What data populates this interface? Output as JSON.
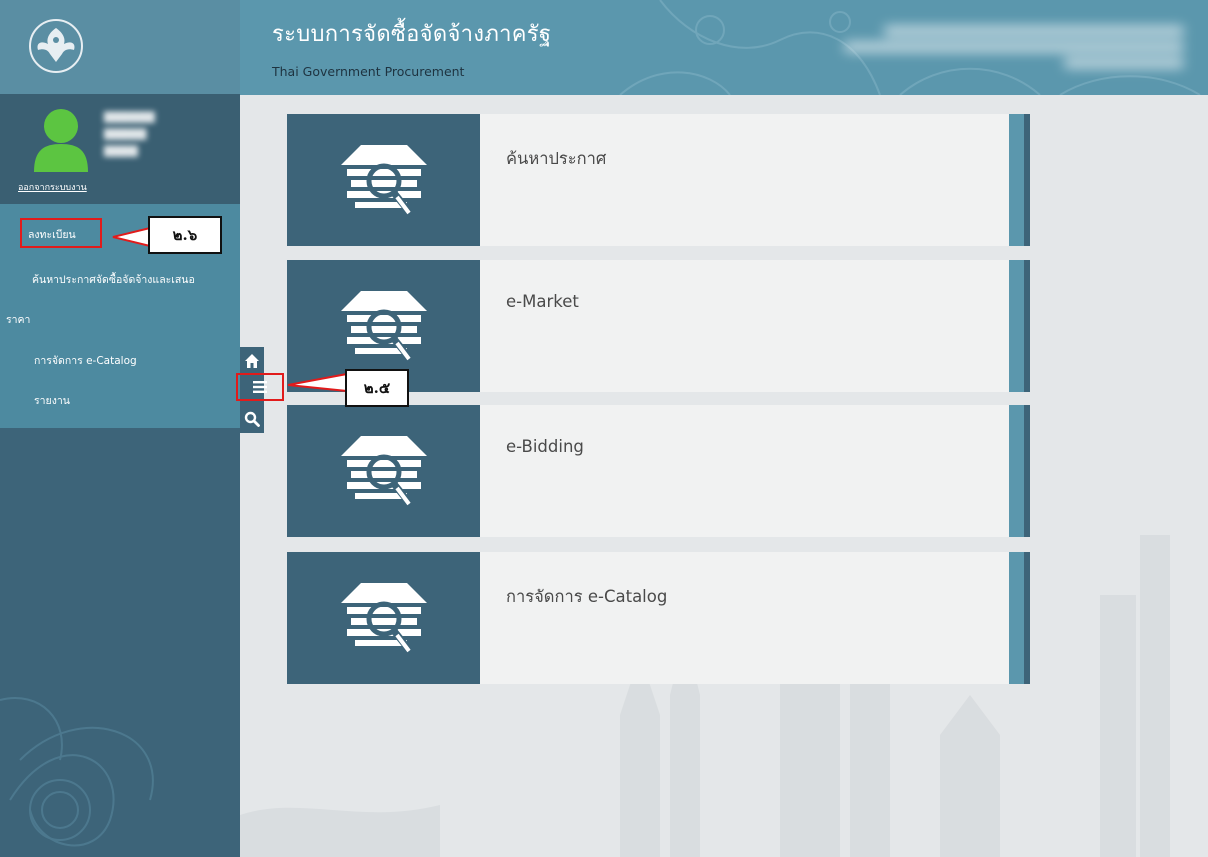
{
  "header": {
    "title": "ระบบการจัดซื้อจัดจ้างภาครัฐ",
    "subtitle": "Thai Government Procurement",
    "logo_icon": "garuda-emblem-icon"
  },
  "profile": {
    "avatar_icon": "user-avatar-icon",
    "logout_label": "ออกจากระบบงาน"
  },
  "menu": {
    "items": [
      {
        "label": "ลงทะเบียน"
      },
      {
        "label": "ค้นหาประกาศจัดซื้อจัดจ้างและเสนอ"
      },
      {
        "label": "ราคา"
      },
      {
        "label": "การจัดการ e-Catalog"
      },
      {
        "label": "รายงาน"
      }
    ]
  },
  "toolbar": {
    "home_icon": "home-icon",
    "menu_icon": "hamburger-menu-icon",
    "search_icon": "search-icon"
  },
  "cards": [
    {
      "label": "ค้นหาประกาศ",
      "icon": "document-search-icon"
    },
    {
      "label": "e-Market",
      "icon": "document-search-icon"
    },
    {
      "label": "e-Bidding",
      "icon": "document-search-icon"
    },
    {
      "label": "การจัดการ e-Catalog",
      "icon": "document-search-icon"
    }
  ],
  "annotations": {
    "step_register": "๒.๖",
    "step_menu": "๒.๕"
  },
  "colors": {
    "sidebar": "#3d6479",
    "header": "#5b97ad",
    "menu": "#4d8aa0",
    "highlight": "#e11b1b",
    "avatar": "#5cc541"
  }
}
